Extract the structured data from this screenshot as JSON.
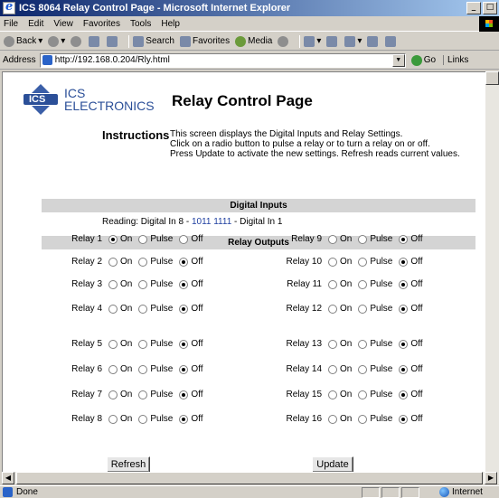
{
  "window": {
    "title": "ICS 8064 Relay Control Page - Microsoft Internet Explorer",
    "min": "_",
    "max": "□"
  },
  "menu": [
    "File",
    "Edit",
    "View",
    "Favorites",
    "Tools",
    "Help"
  ],
  "toolbar": {
    "back": "Back",
    "search": "Search",
    "favorites": "Favorites",
    "media": "Media"
  },
  "address": {
    "label": "Address",
    "url": "http://192.168.0.204/Rly.html",
    "go": "Go",
    "links": "Links"
  },
  "status": {
    "text": "Done",
    "zone": "Internet"
  },
  "page": {
    "logo_line1": "ICS",
    "logo_line2": "ELECTRONICS",
    "logo_mark": "ICS",
    "title": "Relay Control Page",
    "instructions_label": "Instructions",
    "instructions": [
      "This screen displays the Digital Inputs and Relay Settings.",
      "Click on a radio button to pulse a relay or to turn a relay on or off.",
      "Press Update to activate the new settings. Refresh reads current values."
    ],
    "digital_inputs_header": "Digital Inputs",
    "reading_prefix": "Reading:  Digital In 8 - ",
    "reading_bits": "1011 1111",
    "reading_suffix": " - Digital In 1",
    "relay_outputs_header": "Relay Outputs",
    "option_labels": [
      "On",
      "Pulse",
      "Off"
    ],
    "relays_left": [
      {
        "name": "Relay 1",
        "state": "On"
      },
      {
        "name": "Relay 2",
        "state": "Off"
      },
      {
        "name": "Relay 3",
        "state": "Off"
      },
      {
        "name": "Relay 4",
        "state": "Off"
      },
      {
        "name": "Relay 5",
        "state": "Off"
      },
      {
        "name": "Relay 6",
        "state": "Off"
      },
      {
        "name": "Relay 7",
        "state": "Off"
      },
      {
        "name": "Relay 8",
        "state": "Off"
      }
    ],
    "relays_right": [
      {
        "name": "Relay 9",
        "state": "Off"
      },
      {
        "name": "Relay 10",
        "state": "Off"
      },
      {
        "name": "Relay 11",
        "state": "Off"
      },
      {
        "name": "Relay 12",
        "state": "Off"
      },
      {
        "name": "Relay 13",
        "state": "Off"
      },
      {
        "name": "Relay 14",
        "state": "Off"
      },
      {
        "name": "Relay 15",
        "state": "Off"
      },
      {
        "name": "Relay 16",
        "state": "Off"
      }
    ],
    "refresh_button": "Refresh",
    "update_button": "Update"
  }
}
